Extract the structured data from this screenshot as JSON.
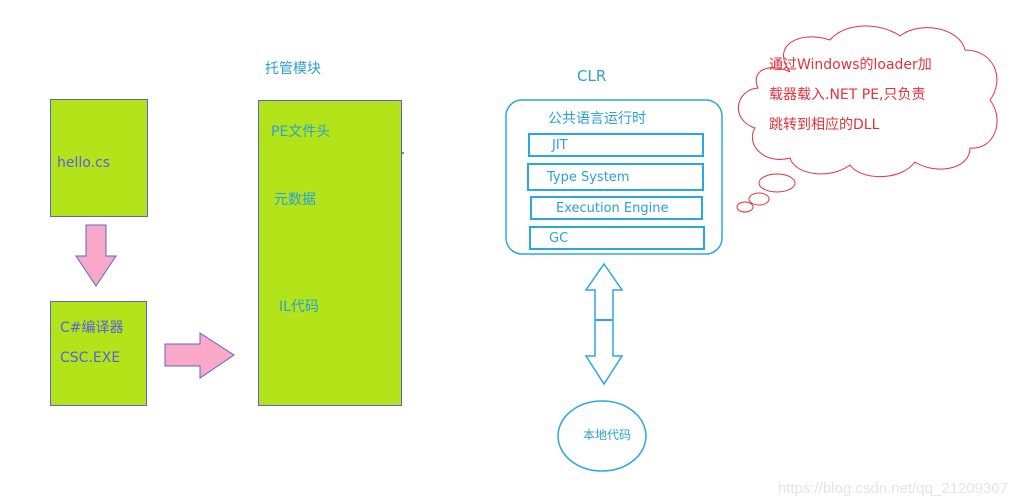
{
  "source_file": {
    "label": "hello.cs"
  },
  "compiler": {
    "line1": "C#编译器",
    "line2": "CSC.EXE"
  },
  "managed_module": {
    "title": "托管模块",
    "sections": [
      {
        "label": "PE文件头"
      },
      {
        "label": "元数据"
      },
      {
        "label": "IL代码"
      }
    ]
  },
  "clr": {
    "title": "CLR",
    "subtitle": "公共语言运行时",
    "components": [
      {
        "label": "JIT"
      },
      {
        "label": "Type System"
      },
      {
        "label": "Execution Engine"
      },
      {
        "label": "GC"
      }
    ]
  },
  "native_code": {
    "label": "本地代码"
  },
  "callout": {
    "lines": [
      "通过Windows的loader加",
      "载器载入.NET PE,只负责",
      "跳转到相应的DLL"
    ]
  },
  "watermark": "https://blog.csdn.net/qq_21209307",
  "colors": {
    "box_fill": "#b3e319",
    "box_border": "#5b63d0",
    "arrow_fill": "#f9a8c8",
    "clr_blue": "#2aa7e0",
    "callout_red": "#e8303a"
  }
}
